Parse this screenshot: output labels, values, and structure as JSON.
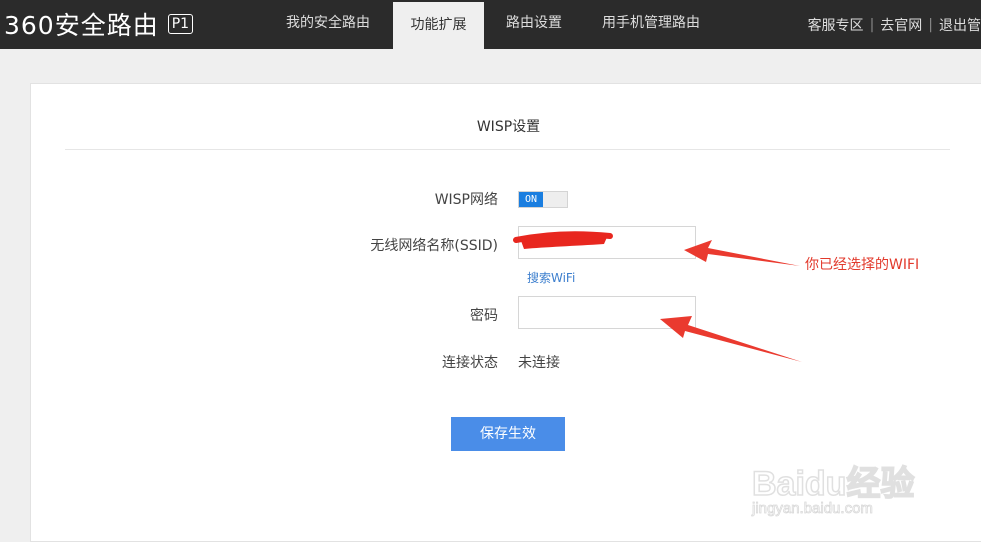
{
  "header": {
    "logo_text": "360安全路由",
    "model_badge": "P1",
    "nav_tabs": [
      {
        "label": "我的安全路由",
        "active": false
      },
      {
        "label": "功能扩展",
        "active": true
      },
      {
        "label": "路由设置",
        "active": false
      },
      {
        "label": "用手机管理路由",
        "active": false
      }
    ],
    "links": [
      "客服专区",
      "去官网",
      "退出管"
    ]
  },
  "wisp": {
    "title": "WISP设置",
    "network_label": "WISP网络",
    "toggle_state": "ON",
    "ssid_label": "无线网络名称(SSID)",
    "ssid_value": "",
    "search_wifi_link": "搜索WiFi",
    "password_label": "密码",
    "password_value": "",
    "status_label": "连接状态",
    "status_value": "未连接",
    "save_button": "保存生效"
  },
  "annotation": {
    "text": "你已经选择的WIFI",
    "color": "#e23a2c"
  },
  "watermark": {
    "brand": "Baidu经验",
    "url": "jingyan.baidu.com"
  },
  "colors": {
    "topbar": "#2b2b2b",
    "accent": "#1a7ee0",
    "button": "#4a8de8",
    "link": "#3d7fce"
  }
}
